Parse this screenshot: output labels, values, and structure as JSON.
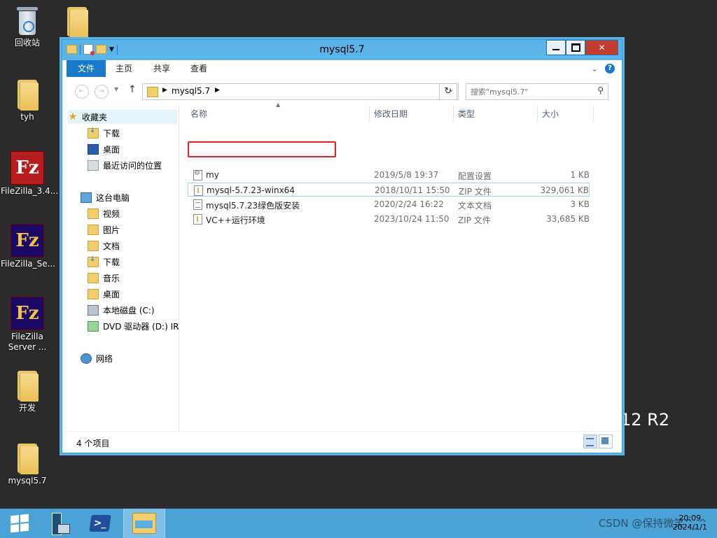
{
  "desktop": {
    "icons": [
      {
        "label": "回收站"
      },
      {
        "label": ""
      },
      {
        "label": "tyh"
      },
      {
        "label": "FileZilla_3.4..."
      },
      {
        "label": "FileZilla_Se..."
      },
      {
        "label": "FileZilla Server ..."
      },
      {
        "label": "开发"
      },
      {
        "label": "mysql5.7"
      }
    ],
    "os_watermark": "12 R2"
  },
  "window": {
    "title": "mysql5.7",
    "ribbon": {
      "tabs": [
        "文件",
        "主页",
        "共享",
        "查看"
      ],
      "help": "?"
    },
    "address": {
      "path": "mysql5.7",
      "search_placeholder": "搜索\"mysql5.7\""
    },
    "nav": {
      "favorites": "收藏夹",
      "fav_items": [
        "下载",
        "桌面",
        "最近访问的位置"
      ],
      "this_pc": "这台电脑",
      "pc_items": [
        "视频",
        "图片",
        "文档",
        "下载",
        "音乐",
        "桌面",
        "本地磁盘 (C:)",
        "DVD 驱动器 (D:) IR"
      ],
      "network": "网络"
    },
    "columns": [
      "名称",
      "修改日期",
      "类型",
      "大小"
    ],
    "files": [
      {
        "name": "my",
        "date": "2019/5/8 19:37",
        "type": "配置设置",
        "size": "1 KB",
        "icon": "config-file-icon"
      },
      {
        "name": "mysql-5.7.23-winx64",
        "date": "2018/10/11 15:50",
        "type": "ZIP 文件",
        "size": "329,061 KB",
        "icon": "zip-file-icon"
      },
      {
        "name": "mysql5.7.23绿色版安装",
        "date": "2020/2/24 16:22",
        "type": "文本文档",
        "size": "3 KB",
        "icon": "text-file-icon"
      },
      {
        "name": "VC++运行环境",
        "date": "2023/10/24 11:50",
        "type": "ZIP 文件",
        "size": "33,685 KB",
        "icon": "zip-file-icon"
      }
    ],
    "status": "4 个项目"
  },
  "taskbar": {
    "clock_time": "20:09",
    "clock_date": "2024/1/1",
    "watermark": "CSDN @保持微笑^_^"
  },
  "colors": {
    "titlebar": "#5ab4e8",
    "file_tab": "#1979ca",
    "close": "#c43c30",
    "highlight_box": "#e0231f",
    "taskbar": "#4aa2d6"
  }
}
